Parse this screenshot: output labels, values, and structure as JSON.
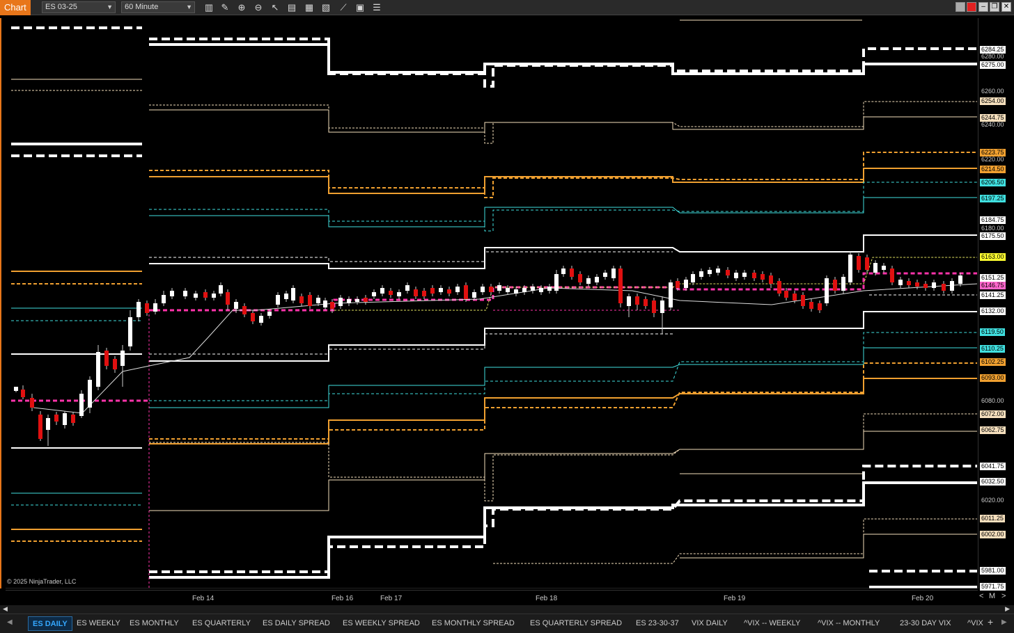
{
  "toolbar": {
    "chart_label": "Chart",
    "instrument": "ES 03-25",
    "interval": "60 Minute",
    "icons": [
      "bar-type-icon",
      "draw-pencil-icon",
      "zoom-in-icon",
      "zoom-out-icon",
      "pointer-icon",
      "data-box-icon",
      "properties-icon",
      "indicators-icon",
      "strategies-icon",
      "chart-trader-icon",
      "menu-icon"
    ]
  },
  "window_buttons": [
    "restore-down-icon",
    "close-red-icon",
    "minimize-icon",
    "maximize-icon",
    "close-icon"
  ],
  "f_button": "F",
  "copyright": "© 2025 NinjaTrader, LLC",
  "time_labels": [
    "Feb 14",
    "Feb 16",
    "Feb 17",
    "Feb 18",
    "Feb 19",
    "Feb 20"
  ],
  "zoom": {
    "minus": "<",
    "m": "M",
    "plus": ">"
  },
  "price_labels": [
    {
      "text": "6284.25",
      "bg": "#ffffff",
      "fg": "#000000"
    },
    {
      "text": "6280.00",
      "bg": "",
      "fg": "#cccccc"
    },
    {
      "text": "6275.00",
      "bg": "#ffffff",
      "fg": "#000000"
    },
    {
      "text": "6260.00",
      "bg": "",
      "fg": "#cccccc"
    },
    {
      "text": "6254.00",
      "bg": "#f5dfbd",
      "fg": "#000000"
    },
    {
      "text": "6244.75",
      "bg": "#f5dfbd",
      "fg": "#000000"
    },
    {
      "text": "6240.00",
      "bg": "",
      "fg": "#cccccc"
    },
    {
      "text": "6223.75",
      "bg": "#f0a030",
      "fg": "#000000"
    },
    {
      "text": "6220.00",
      "bg": "",
      "fg": "#cccccc"
    },
    {
      "text": "6214.50",
      "bg": "#f0a030",
      "fg": "#000000"
    },
    {
      "text": "6206.50",
      "bg": "#40e0e0",
      "fg": "#000000"
    },
    {
      "text": "6197.25",
      "bg": "#40e0e0",
      "fg": "#000000"
    },
    {
      "text": "6184.75",
      "bg": "#ffffff",
      "fg": "#000000"
    },
    {
      "text": "6180.00",
      "bg": "",
      "fg": "#cccccc"
    },
    {
      "text": "6175.50",
      "bg": "#ffffff",
      "fg": "#000000"
    },
    {
      "text": "6163.00",
      "bg": "#ffff30",
      "fg": "#000000"
    },
    {
      "text": "6151.25",
      "bg": "#ffffff",
      "fg": "#000000"
    },
    {
      "text": "6146.75",
      "bg": "#ff66cc",
      "fg": "#000000"
    },
    {
      "text": "6141.25",
      "bg": "#ffffff",
      "fg": "#000000"
    },
    {
      "text": "6132.00",
      "bg": "#ffffff",
      "fg": "#000000"
    },
    {
      "text": "6119.50",
      "bg": "#40e0e0",
      "fg": "#000000"
    },
    {
      "text": "6110.25",
      "bg": "#40e0e0",
      "fg": "#000000"
    },
    {
      "text": "6102.25",
      "bg": "#f0a030",
      "fg": "#000000"
    },
    {
      "text": "6093.00",
      "bg": "#f0a030",
      "fg": "#000000"
    },
    {
      "text": "6080.00",
      "bg": "",
      "fg": "#cccccc"
    },
    {
      "text": "6072.00",
      "bg": "#f5dfbd",
      "fg": "#000000"
    },
    {
      "text": "6062.75",
      "bg": "#f5dfbd",
      "fg": "#000000"
    },
    {
      "text": "6041.75",
      "bg": "#ffffff",
      "fg": "#000000"
    },
    {
      "text": "6032.50",
      "bg": "#ffffff",
      "fg": "#000000"
    },
    {
      "text": "6020.00",
      "bg": "",
      "fg": "#cccccc"
    },
    {
      "text": "6011.25",
      "bg": "#f5dfbd",
      "fg": "#000000"
    },
    {
      "text": "6002.00",
      "bg": "#f5dfbd",
      "fg": "#000000"
    },
    {
      "text": "5981.00",
      "bg": "#ffffff",
      "fg": "#000000"
    },
    {
      "text": "5971.75",
      "bg": "#ffffff",
      "fg": "#000000"
    }
  ],
  "tabs": [
    {
      "label": "ES DAILY",
      "active": true
    },
    {
      "label": "ES WEEKLY",
      "active": false
    },
    {
      "label": "ES MONTHLY",
      "active": false
    },
    {
      "label": "ES QUARTERLY",
      "active": false
    },
    {
      "label": "ES DAILY SPREAD",
      "active": false
    },
    {
      "label": "ES WEEKLY SPREAD",
      "active": false
    },
    {
      "label": "ES MONTHLY SPREAD",
      "active": false
    },
    {
      "label": "ES QUARTERLY SPREAD",
      "active": false
    },
    {
      "label": "ES 23-30-37",
      "active": false
    },
    {
      "label": "VIX DAILY",
      "active": false
    },
    {
      "label": "^VIX -- WEEKLY",
      "active": false
    },
    {
      "label": "^VIX -- MONTHLY",
      "active": false
    },
    {
      "label": "23-30 DAY VIX",
      "active": false
    },
    {
      "label": "^VIX",
      "active": false
    }
  ],
  "colors": {
    "white": "#ffffff",
    "tan": "#f5dfbd",
    "orange": "#f0a030",
    "cyan": "#40e0e0",
    "magenta": "#ff3399",
    "yellow": "#e0e060",
    "up_candle": "#ffffff",
    "down_candle": "#e01010"
  }
}
